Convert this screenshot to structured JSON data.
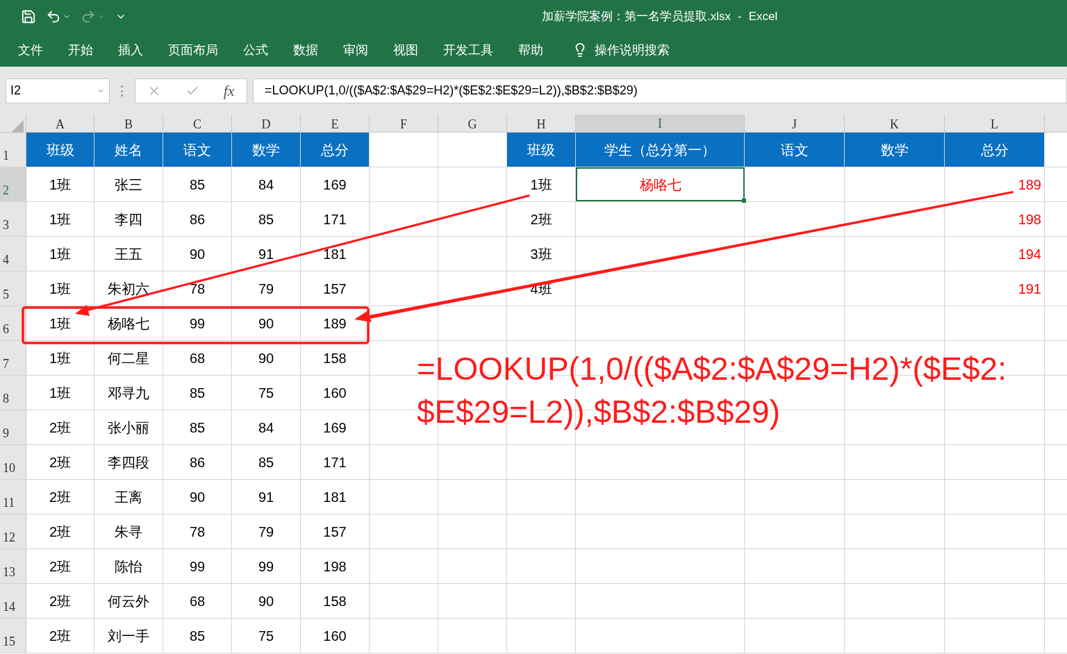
{
  "title_bar": {
    "title": "加薪学院案例：第一名学员提取.xlsx",
    "separator": "-",
    "app": "Excel"
  },
  "ribbon_tabs": [
    "文件",
    "开始",
    "插入",
    "页面布局",
    "公式",
    "数据",
    "审阅",
    "视图",
    "开发工具",
    "帮助"
  ],
  "tell_me": "操作说明搜索",
  "name_box": "I2",
  "fx_label": "fx",
  "formula": "=LOOKUP(1,0/(($A$2:$A$29=H2)*($E$2:$E$29=L2)),$B$2:$B$29)",
  "columns": [
    {
      "letter": "A",
      "selected": false
    },
    {
      "letter": "B",
      "selected": false
    },
    {
      "letter": "C",
      "selected": false
    },
    {
      "letter": "D",
      "selected": false
    },
    {
      "letter": "E",
      "selected": false
    },
    {
      "letter": "F",
      "selected": false
    },
    {
      "letter": "G",
      "selected": false
    },
    {
      "letter": "H",
      "selected": false
    },
    {
      "letter": "I",
      "selected": true
    },
    {
      "letter": "J",
      "selected": false
    },
    {
      "letter": "K",
      "selected": false
    },
    {
      "letter": "L",
      "selected": false
    }
  ],
  "rows": [
    {
      "number": "1",
      "selected": false,
      "cells": [
        {
          "text": "班级",
          "kind": "header",
          "selected": false
        },
        {
          "text": "姓名",
          "kind": "header",
          "selected": false
        },
        {
          "text": "语文",
          "kind": "header",
          "selected": false
        },
        {
          "text": "数学",
          "kind": "header",
          "selected": false
        },
        {
          "text": "总分",
          "kind": "header",
          "selected": false
        },
        null,
        null,
        {
          "text": "班级",
          "kind": "header",
          "selected": false
        },
        {
          "text": "学生（总分第一）",
          "kind": "header",
          "selected": false
        },
        {
          "text": "语文",
          "kind": "header",
          "selected": false
        },
        {
          "text": "数学",
          "kind": "header",
          "selected": false
        },
        {
          "text": "总分",
          "kind": "header",
          "selected": false
        }
      ]
    },
    {
      "number": "2",
      "selected": true,
      "cells": [
        {
          "text": "1班",
          "kind": "value",
          "selected": false
        },
        {
          "text": "张三",
          "kind": "value",
          "selected": false
        },
        {
          "text": "85",
          "kind": "value",
          "selected": false
        },
        {
          "text": "84",
          "kind": "value",
          "selected": false
        },
        {
          "text": "169",
          "kind": "value",
          "selected": false
        },
        null,
        null,
        {
          "text": "1班",
          "kind": "value",
          "selected": false
        },
        {
          "text": "杨咯七",
          "kind": "result-name",
          "selected": true
        },
        null,
        null,
        {
          "text": "189",
          "kind": "result-number",
          "selected": false
        }
      ]
    },
    {
      "number": "3",
      "selected": false,
      "cells": [
        {
          "text": "1班",
          "kind": "value",
          "selected": false
        },
        {
          "text": "李四",
          "kind": "value",
          "selected": false
        },
        {
          "text": "86",
          "kind": "value",
          "selected": false
        },
        {
          "text": "85",
          "kind": "value",
          "selected": false
        },
        {
          "text": "171",
          "kind": "value",
          "selected": false
        },
        null,
        null,
        {
          "text": "2班",
          "kind": "value",
          "selected": false
        },
        null,
        null,
        null,
        {
          "text": "198",
          "kind": "result-number",
          "selected": false
        }
      ]
    },
    {
      "number": "4",
      "selected": false,
      "cells": [
        {
          "text": "1班",
          "kind": "value",
          "selected": false
        },
        {
          "text": "王五",
          "kind": "value",
          "selected": false
        },
        {
          "text": "90",
          "kind": "value",
          "selected": false
        },
        {
          "text": "91",
          "kind": "value",
          "selected": false
        },
        {
          "text": "181",
          "kind": "value",
          "selected": false
        },
        null,
        null,
        {
          "text": "3班",
          "kind": "value",
          "selected": false
        },
        null,
        null,
        null,
        {
          "text": "194",
          "kind": "result-number",
          "selected": false
        }
      ]
    },
    {
      "number": "5",
      "selected": false,
      "cells": [
        {
          "text": "1班",
          "kind": "value",
          "selected": false
        },
        {
          "text": "朱初六",
          "kind": "value",
          "selected": false
        },
        {
          "text": "78",
          "kind": "value",
          "selected": false
        },
        {
          "text": "79",
          "kind": "value",
          "selected": false
        },
        {
          "text": "157",
          "kind": "value",
          "selected": false
        },
        null,
        null,
        {
          "text": "4班",
          "kind": "value",
          "selected": false
        },
        null,
        null,
        null,
        {
          "text": "191",
          "kind": "result-number",
          "selected": false
        }
      ]
    },
    {
      "number": "6",
      "selected": false,
      "cells": [
        {
          "text": "1班",
          "kind": "value",
          "selected": false
        },
        {
          "text": "杨咯七",
          "kind": "value",
          "selected": false
        },
        {
          "text": "99",
          "kind": "value",
          "selected": false
        },
        {
          "text": "90",
          "kind": "value",
          "selected": false
        },
        {
          "text": "189",
          "kind": "value",
          "selected": false
        }
      ]
    },
    {
      "number": "7",
      "selected": false,
      "cells": [
        {
          "text": "1班",
          "kind": "value",
          "selected": false
        },
        {
          "text": "何二星",
          "kind": "value",
          "selected": false
        },
        {
          "text": "68",
          "kind": "value",
          "selected": false
        },
        {
          "text": "90",
          "kind": "value",
          "selected": false
        },
        {
          "text": "158",
          "kind": "value",
          "selected": false
        }
      ]
    },
    {
      "number": "8",
      "selected": false,
      "cells": [
        {
          "text": "1班",
          "kind": "value",
          "selected": false
        },
        {
          "text": "邓寻九",
          "kind": "value",
          "selected": false
        },
        {
          "text": "85",
          "kind": "value",
          "selected": false
        },
        {
          "text": "75",
          "kind": "value",
          "selected": false
        },
        {
          "text": "160",
          "kind": "value",
          "selected": false
        }
      ]
    },
    {
      "number": "9",
      "selected": false,
      "cells": [
        {
          "text": "2班",
          "kind": "value",
          "selected": false
        },
        {
          "text": "张小丽",
          "kind": "value",
          "selected": false
        },
        {
          "text": "85",
          "kind": "value",
          "selected": false
        },
        {
          "text": "84",
          "kind": "value",
          "selected": false
        },
        {
          "text": "169",
          "kind": "value",
          "selected": false
        }
      ]
    },
    {
      "number": "10",
      "selected": false,
      "cells": [
        {
          "text": "2班",
          "kind": "value",
          "selected": false
        },
        {
          "text": "李四段",
          "kind": "value",
          "selected": false
        },
        {
          "text": "86",
          "kind": "value",
          "selected": false
        },
        {
          "text": "85",
          "kind": "value",
          "selected": false
        },
        {
          "text": "171",
          "kind": "value",
          "selected": false
        }
      ]
    },
    {
      "number": "11",
      "selected": false,
      "cells": [
        {
          "text": "2班",
          "kind": "value",
          "selected": false
        },
        {
          "text": "王离",
          "kind": "value",
          "selected": false
        },
        {
          "text": "90",
          "kind": "value",
          "selected": false
        },
        {
          "text": "91",
          "kind": "value",
          "selected": false
        },
        {
          "text": "181",
          "kind": "value",
          "selected": false
        }
      ]
    },
    {
      "number": "12",
      "selected": false,
      "cells": [
        {
          "text": "2班",
          "kind": "value",
          "selected": false
        },
        {
          "text": "朱寻",
          "kind": "value",
          "selected": false
        },
        {
          "text": "78",
          "kind": "value",
          "selected": false
        },
        {
          "text": "79",
          "kind": "value",
          "selected": false
        },
        {
          "text": "157",
          "kind": "value",
          "selected": false
        }
      ]
    },
    {
      "number": "13",
      "selected": false,
      "cells": [
        {
          "text": "2班",
          "kind": "value",
          "selected": false
        },
        {
          "text": "陈怡",
          "kind": "value",
          "selected": false
        },
        {
          "text": "99",
          "kind": "value",
          "selected": false
        },
        {
          "text": "99",
          "kind": "value",
          "selected": false
        },
        {
          "text": "198",
          "kind": "value",
          "selected": false
        }
      ]
    },
    {
      "number": "14",
      "selected": false,
      "cells": [
        {
          "text": "2班",
          "kind": "value",
          "selected": false
        },
        {
          "text": "何云外",
          "kind": "value",
          "selected": false
        },
        {
          "text": "68",
          "kind": "value",
          "selected": false
        },
        {
          "text": "90",
          "kind": "value",
          "selected": false
        },
        {
          "text": "158",
          "kind": "value",
          "selected": false
        }
      ]
    },
    {
      "number": "15",
      "selected": false,
      "cells": [
        {
          "text": "2班",
          "kind": "value",
          "selected": false
        },
        {
          "text": "刘一手",
          "kind": "value",
          "selected": false
        },
        {
          "text": "85",
          "kind": "value",
          "selected": false
        },
        {
          "text": "75",
          "kind": "value",
          "selected": false
        },
        {
          "text": "160",
          "kind": "value",
          "selected": false
        }
      ]
    }
  ],
  "annotation": {
    "lines": [
      "=LOOKUP(1,0/(($A$2:$A$29=H2)*($E$2:",
      "$E$29=L2)),$B$2:$B$29)"
    ]
  }
}
